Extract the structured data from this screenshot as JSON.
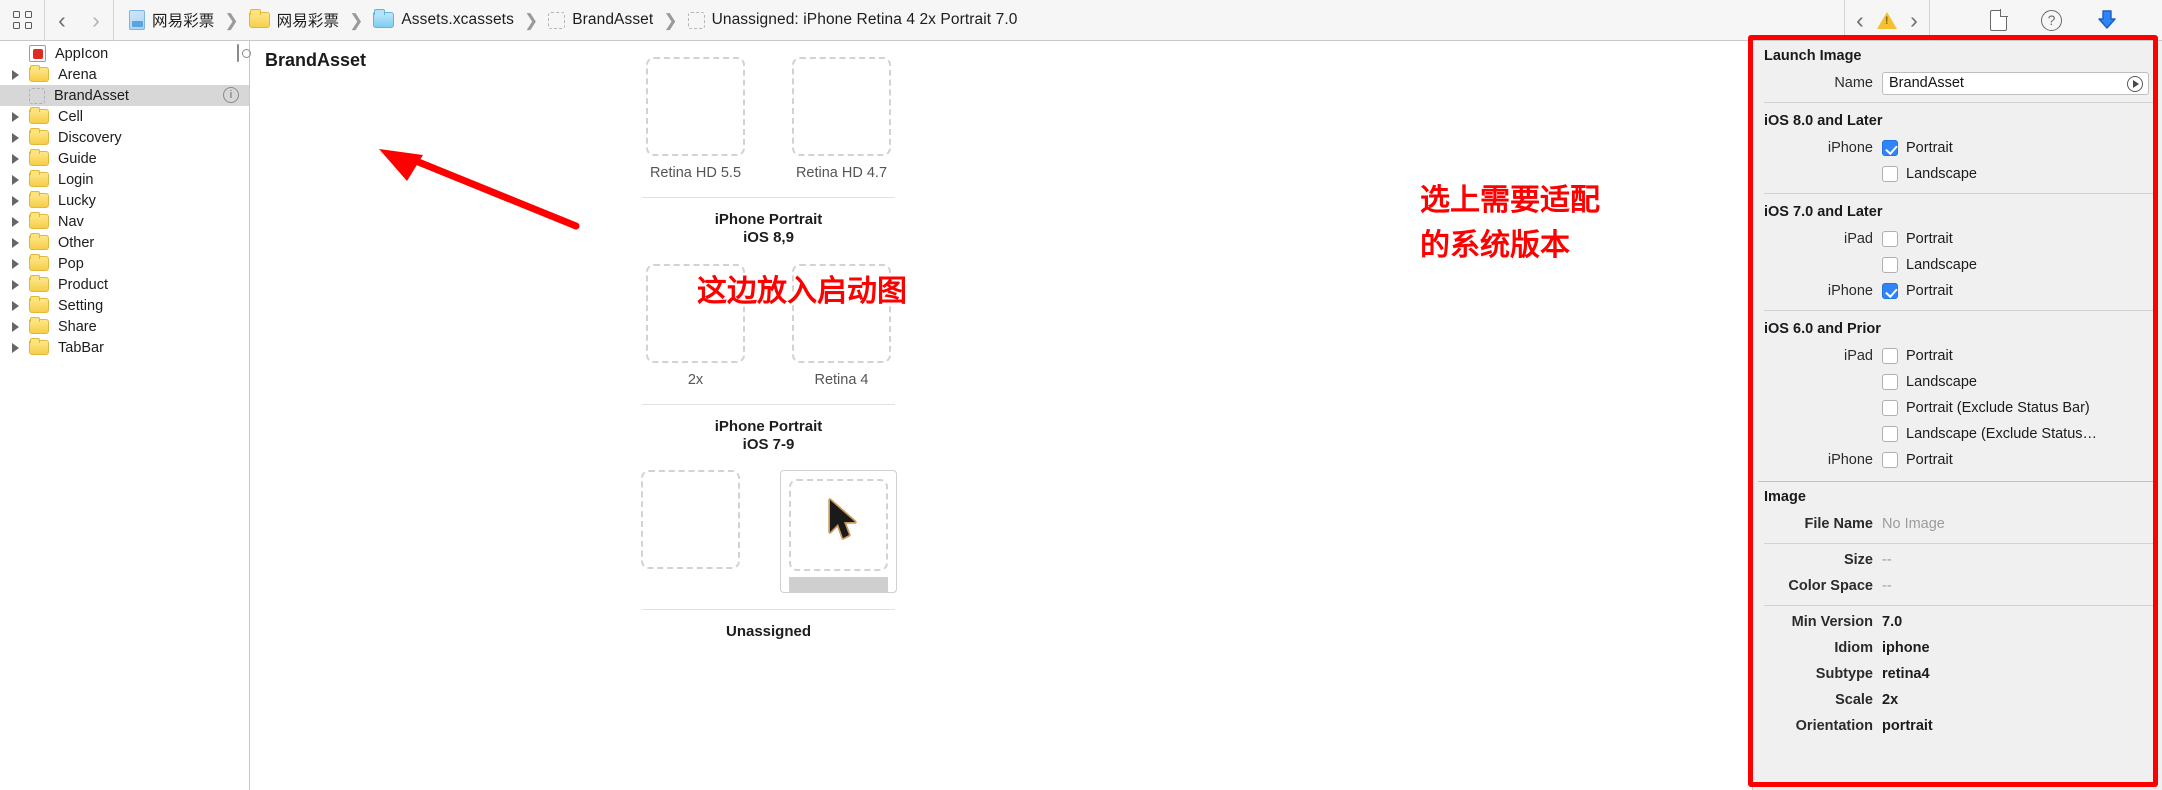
{
  "toolbar": {
    "grid_icon": "grid-icon",
    "back_label": "‹",
    "forward_label": "›",
    "breadcrumbs": [
      {
        "label": "网易彩票",
        "icon": "project-document-icon"
      },
      {
        "label": "网易彩票",
        "icon": "folder-icon"
      },
      {
        "label": "Assets.xcassets",
        "icon": "xcassets-icon"
      },
      {
        "label": "BrandAsset",
        "icon": "asset-slot-icon"
      },
      {
        "label": "Unassigned: iPhone Retina 4 2x Portrait 7.0",
        "icon": "asset-slot-icon"
      }
    ],
    "issue_prev": "‹",
    "issue_next": "›",
    "warning_icon": "warning-triangle-icon",
    "right_icons": [
      "page-icon",
      "help-icon",
      "download-icon"
    ]
  },
  "sidebar": {
    "items": [
      {
        "label": "AppIcon",
        "icon": "appicon-icon",
        "disclosure": false,
        "selected": false,
        "trailing": "grid-badge-icon"
      },
      {
        "label": "Arena",
        "icon": "folder-icon",
        "disclosure": true,
        "selected": false,
        "trailing": ""
      },
      {
        "label": "BrandAsset",
        "icon": "asset-slot-icon",
        "disclosure": false,
        "selected": true,
        "trailing": "info-badge-icon"
      },
      {
        "label": "Cell",
        "icon": "folder-icon",
        "disclosure": true,
        "selected": false,
        "trailing": ""
      },
      {
        "label": "Discovery",
        "icon": "folder-icon",
        "disclosure": true,
        "selected": false,
        "trailing": ""
      },
      {
        "label": "Guide",
        "icon": "folder-icon",
        "disclosure": true,
        "selected": false,
        "trailing": ""
      },
      {
        "label": "Login",
        "icon": "folder-icon",
        "disclosure": true,
        "selected": false,
        "trailing": ""
      },
      {
        "label": "Lucky",
        "icon": "folder-icon",
        "disclosure": true,
        "selected": false,
        "trailing": ""
      },
      {
        "label": "Nav",
        "icon": "folder-icon",
        "disclosure": true,
        "selected": false,
        "trailing": ""
      },
      {
        "label": "Other",
        "icon": "folder-icon",
        "disclosure": true,
        "selected": false,
        "trailing": ""
      },
      {
        "label": "Pop",
        "icon": "folder-icon",
        "disclosure": true,
        "selected": false,
        "trailing": ""
      },
      {
        "label": "Product",
        "icon": "folder-icon",
        "disclosure": true,
        "selected": false,
        "trailing": ""
      },
      {
        "label": "Setting",
        "icon": "folder-icon",
        "disclosure": true,
        "selected": false,
        "trailing": ""
      },
      {
        "label": "Share",
        "icon": "folder-icon",
        "disclosure": true,
        "selected": false,
        "trailing": ""
      },
      {
        "label": "TabBar",
        "icon": "folder-icon",
        "disclosure": true,
        "selected": false,
        "trailing": ""
      }
    ]
  },
  "canvas": {
    "title": "BrandAsset",
    "groups": [
      {
        "slots": [
          {
            "caption": "Retina HD 5.5",
            "selected": false
          },
          {
            "caption": "Retina HD 4.7",
            "selected": false
          }
        ],
        "group_title_line1": "iPhone Portrait",
        "group_title_line2": "iOS 8,9"
      },
      {
        "slots": [
          {
            "caption": "2x",
            "selected": false
          },
          {
            "caption": "Retina 4",
            "selected": false
          }
        ],
        "group_title_line1": "iPhone Portrait",
        "group_title_line2": "iOS 7-9"
      },
      {
        "slots": [
          {
            "caption": "",
            "selected": false
          },
          {
            "caption": "",
            "selected": true
          }
        ],
        "group_title_line1": "Unassigned",
        "group_title_line2": ""
      }
    ]
  },
  "annotations": {
    "left_note": "这边放入启动图",
    "right_note_line1": "选上需要适配",
    "right_note_line2": "的系统版本",
    "color": "#ff0000"
  },
  "inspector": {
    "launch_image": {
      "section_title": "Launch Image",
      "name_label": "Name",
      "name_value": "BrandAsset"
    },
    "ios8": {
      "section_title": "iOS 8.0 and Later",
      "rows": [
        {
          "device": "iPhone",
          "label": "Portrait",
          "checked": true
        },
        {
          "device": "",
          "label": "Landscape",
          "checked": false
        }
      ]
    },
    "ios7": {
      "section_title": "iOS 7.0 and Later",
      "rows": [
        {
          "device": "iPad",
          "label": "Portrait",
          "checked": false
        },
        {
          "device": "",
          "label": "Landscape",
          "checked": false
        },
        {
          "device": "iPhone",
          "label": "Portrait",
          "checked": true
        }
      ]
    },
    "ios6": {
      "section_title": "iOS 6.0 and Prior",
      "rows": [
        {
          "device": "iPad",
          "label": "Portrait",
          "checked": false
        },
        {
          "device": "",
          "label": "Landscape",
          "checked": false
        },
        {
          "device": "",
          "label": "Portrait (Exclude Status Bar)",
          "checked": false
        },
        {
          "device": "",
          "label": "Landscape (Exclude Status…",
          "checked": false
        },
        {
          "device": "iPhone",
          "label": "Portrait",
          "checked": false
        }
      ]
    },
    "image": {
      "section_title": "Image",
      "file_name_label": "File Name",
      "file_name_value": "No Image",
      "size_label": "Size",
      "size_value": "--",
      "color_space_label": "Color Space",
      "color_space_value": "--",
      "min_version_label": "Min Version",
      "min_version_value": "7.0",
      "idiom_label": "Idiom",
      "idiom_value": "iphone",
      "subtype_label": "Subtype",
      "subtype_value": "retina4",
      "scale_label": "Scale",
      "scale_value": "2x",
      "orientation_label": "Orientation",
      "orientation_value": "portrait"
    }
  }
}
